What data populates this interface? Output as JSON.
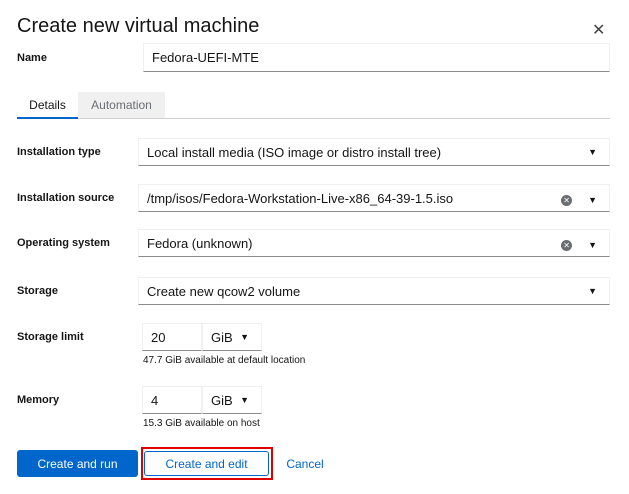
{
  "dialog": {
    "title": "Create new virtual machine",
    "close_icon": "close-icon"
  },
  "name": {
    "label": "Name",
    "value": "Fedora-UEFI-MTE"
  },
  "tabs": [
    {
      "label": "Details",
      "active": true
    },
    {
      "label": "Automation",
      "active": false
    }
  ],
  "fields": {
    "installation_type": {
      "label": "Installation type",
      "value": "Local install media (ISO image or distro install tree)"
    },
    "installation_source": {
      "label": "Installation source",
      "value": "/tmp/isos/Fedora-Workstation-Live-x86_64-39-1.5.iso"
    },
    "operating_system": {
      "label": "Operating system",
      "value": "Fedora (unknown)"
    },
    "storage": {
      "label": "Storage",
      "value": "Create new qcow2 volume"
    },
    "storage_limit": {
      "label": "Storage limit",
      "value": "20",
      "unit": "GiB",
      "help": "47.7 GiB available at default location"
    },
    "memory": {
      "label": "Memory",
      "value": "4",
      "unit": "GiB",
      "help": "15.3 GiB available on host"
    }
  },
  "buttons": {
    "create_run": "Create and run",
    "create_edit": "Create and edit",
    "cancel": "Cancel"
  },
  "colors": {
    "primary": "#0066cc",
    "highlight": "#e00000"
  }
}
